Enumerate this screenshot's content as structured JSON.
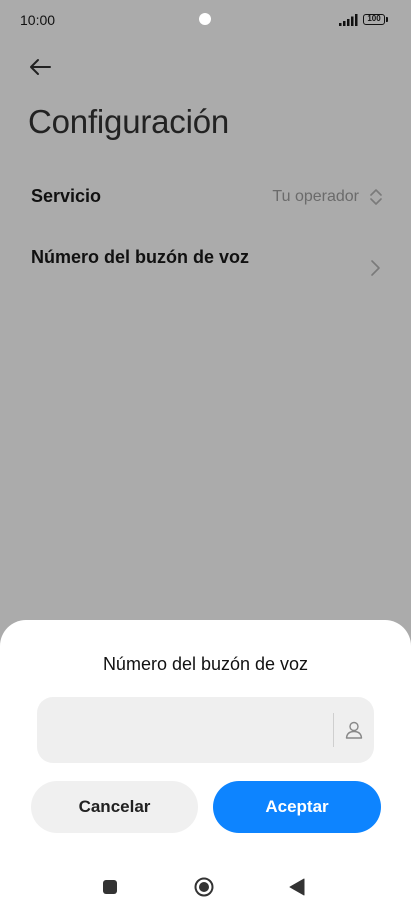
{
  "status_bar": {
    "time": "10:00",
    "battery": "100"
  },
  "header": {
    "title": "Configuración"
  },
  "settings": {
    "items": [
      {
        "label": "Servicio",
        "value": "Tu operador"
      },
      {
        "label": "Número del buzón de voz"
      }
    ]
  },
  "dialog": {
    "title": "Número del buzón de voz",
    "input_value": "",
    "input_placeholder": "",
    "cancel_label": "Cancelar",
    "accept_label": "Aceptar"
  },
  "colors": {
    "background_dim": "#ababab",
    "accent": "#0d84ff",
    "sheet": "#ffffff",
    "input_bg": "#efefef"
  },
  "icons": [
    "back-arrow-icon",
    "updown-icon",
    "chevron-right-icon",
    "contact-icon",
    "recents-icon",
    "home-icon",
    "back-icon"
  ]
}
